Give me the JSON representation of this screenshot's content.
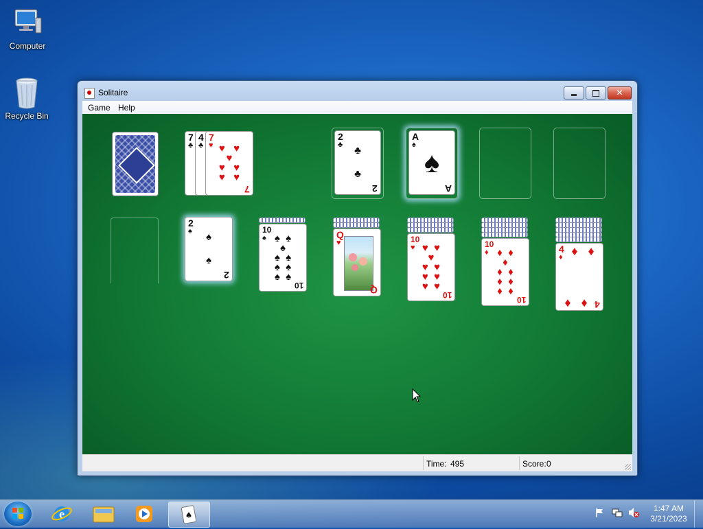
{
  "desktop": {
    "icons": [
      {
        "label": "Computer",
        "icon": "computer-icon"
      },
      {
        "label": "Recycle Bin",
        "icon": "recycle-bin-icon"
      }
    ]
  },
  "window": {
    "title": "Solitaire",
    "controls": {
      "minimize": "minimize",
      "maximize": "maximize",
      "close": "✕"
    },
    "menu": [
      "Game",
      "Help"
    ]
  },
  "game": {
    "stock": {
      "face_down": true
    },
    "waste": [
      {
        "rank": "7",
        "suit": "♣",
        "color": "black"
      },
      {
        "rank": "4",
        "suit": "♣",
        "color": "black"
      },
      {
        "rank": "7",
        "suit": "♥",
        "color": "red"
      }
    ],
    "foundations": [
      {
        "rank": "2",
        "suit": "♣",
        "color": "black"
      },
      {
        "rank": "A",
        "suit": "♠",
        "color": "black"
      },
      null,
      null
    ],
    "tableau": [
      {
        "hidden": 0,
        "top": null
      },
      {
        "hidden": 0,
        "top": {
          "rank": "2",
          "suit": "♠",
          "color": "black"
        }
      },
      {
        "hidden": 1,
        "top": {
          "rank": "10",
          "suit": "♠",
          "color": "black"
        }
      },
      {
        "hidden": 2,
        "top": {
          "rank": "Q",
          "suit": "♥",
          "color": "red"
        }
      },
      {
        "hidden": 3,
        "top": {
          "rank": "10",
          "suit": "♥",
          "color": "red"
        }
      },
      {
        "hidden": 4,
        "top": {
          "rank": "10",
          "suit": "♦",
          "color": "red"
        }
      },
      {
        "hidden": 5,
        "top": {
          "rank": "4",
          "suit": "♦",
          "color": "red"
        }
      }
    ]
  },
  "status": {
    "time_label": "Time:",
    "time_value": "495",
    "score_label": "Score:",
    "score_value": "0"
  },
  "taskbar": {
    "pinned": [
      "internet-explorer-icon",
      "windows-explorer-icon",
      "media-player-icon",
      "solitaire-icon"
    ],
    "tray": [
      "action-center-flag-icon",
      "network-icon",
      "volume-muted-icon"
    ],
    "time": "1:47 AM",
    "date": "3/21/2023"
  },
  "colors": {
    "felt": "#127a35",
    "red_suit": "#d11111",
    "black_suit": "#111111"
  }
}
